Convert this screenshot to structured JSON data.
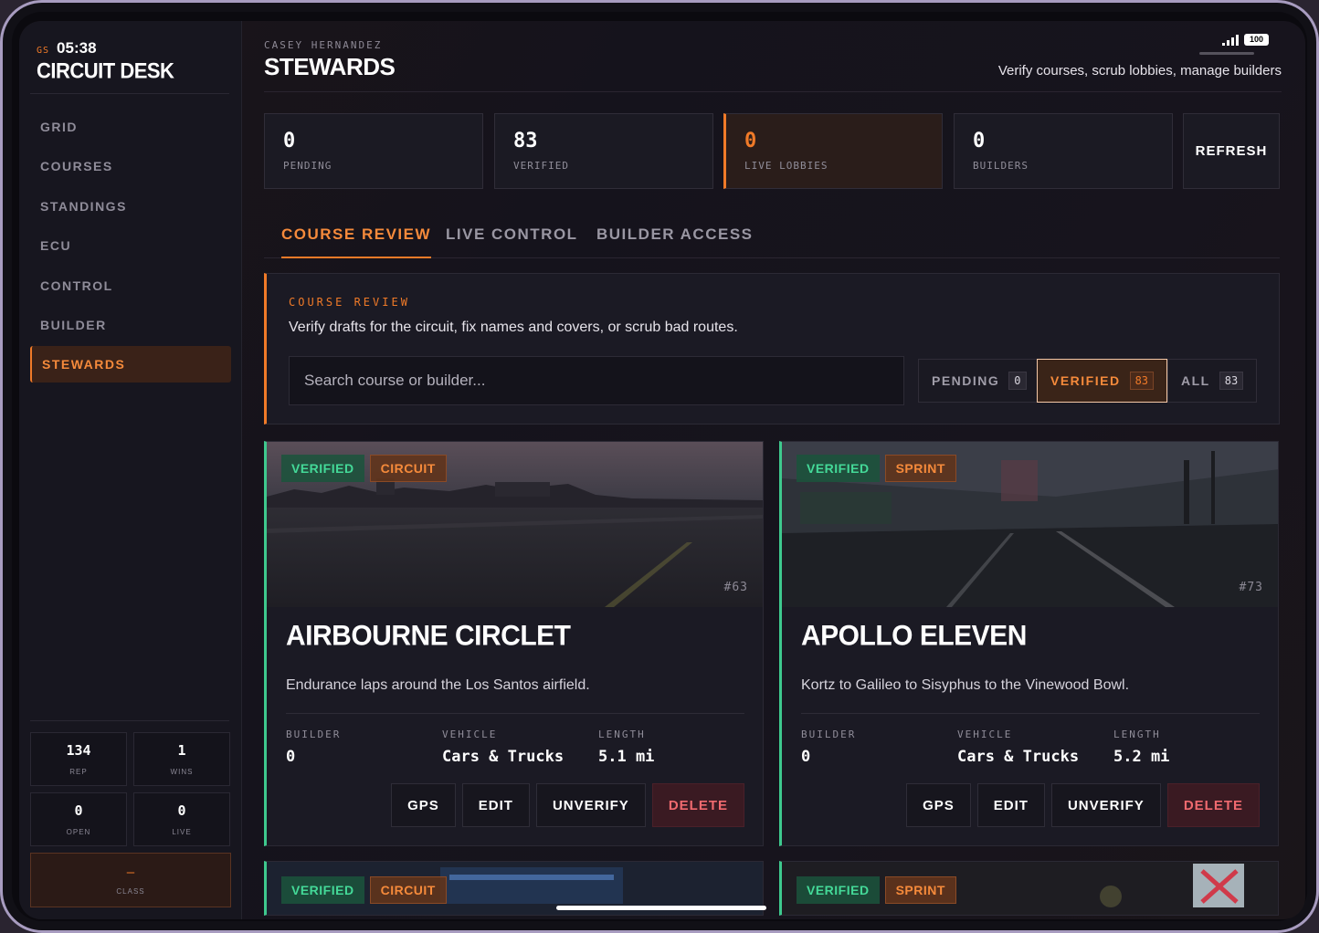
{
  "brand": {
    "tag": "GS",
    "time": "05:38",
    "title": "CIRCUIT DESK"
  },
  "nav": [
    {
      "label": "GRID"
    },
    {
      "label": "COURSES"
    },
    {
      "label": "STANDINGS"
    },
    {
      "label": "ECU"
    },
    {
      "label": "CONTROL"
    },
    {
      "label": "BUILDER"
    },
    {
      "label": "STEWARDS",
      "active": true
    }
  ],
  "side_stats": [
    {
      "value": "134",
      "label": "REP"
    },
    {
      "value": "1",
      "label": "WINS"
    },
    {
      "value": "0",
      "label": "OPEN"
    },
    {
      "value": "0",
      "label": "LIVE"
    }
  ],
  "class_box": {
    "value": "—",
    "label": "CLASS"
  },
  "header": {
    "user": "CASEY HERNANDEZ",
    "title": "STEWARDS",
    "subtitle": "Verify courses, scrub lobbies, manage builders",
    "battery": "100"
  },
  "stat_cards": [
    {
      "value": "0",
      "label": "PENDING"
    },
    {
      "value": "83",
      "label": "VERIFIED"
    },
    {
      "value": "0",
      "label": "LIVE LOBBIES",
      "highlight": true
    },
    {
      "value": "0",
      "label": "BUILDERS"
    }
  ],
  "refresh_label": "REFRESH",
  "tabs": [
    {
      "label": "COURSE REVIEW",
      "active": true
    },
    {
      "label": "LIVE CONTROL"
    },
    {
      "label": "BUILDER ACCESS"
    }
  ],
  "review": {
    "kicker": "COURSE REVIEW",
    "description": "Verify drafts for the circuit, fix names and covers, or scrub bad routes.",
    "search_placeholder": "Search course or builder...",
    "filters": [
      {
        "label": "PENDING",
        "count": "0"
      },
      {
        "label": "VERIFIED",
        "count": "83",
        "active": true
      },
      {
        "label": "ALL",
        "count": "83"
      }
    ]
  },
  "meta_labels": {
    "builder": "BUILDER",
    "vehicle": "VEHICLE",
    "length": "LENGTH"
  },
  "actions": {
    "gps": "GPS",
    "edit": "EDIT",
    "unverify": "UNVERIFY",
    "delete": "DELETE"
  },
  "courses": [
    {
      "status": "VERIFIED",
      "type": "CIRCUIT",
      "id": "#63",
      "name": "AIRBOURNE CIRCLET",
      "description": "Endurance laps around the Los Santos airfield.",
      "builder": "0",
      "vehicle": "Cars & Trucks",
      "length": "5.1 mi"
    },
    {
      "status": "VERIFIED",
      "type": "SPRINT",
      "id": "#73",
      "name": "APOLLO ELEVEN",
      "description": "Kortz to Galileo to Sisyphus to the Vinewood Bowl.",
      "builder": "0",
      "vehicle": "Cars & Trucks",
      "length": "5.2 mi"
    },
    {
      "status": "VERIFIED",
      "type": "CIRCUIT"
    },
    {
      "status": "VERIFIED",
      "type": "SPRINT"
    }
  ],
  "colors": {
    "accent": "#f07a28",
    "verified": "#3ec98e",
    "danger": "#f06a6f"
  }
}
